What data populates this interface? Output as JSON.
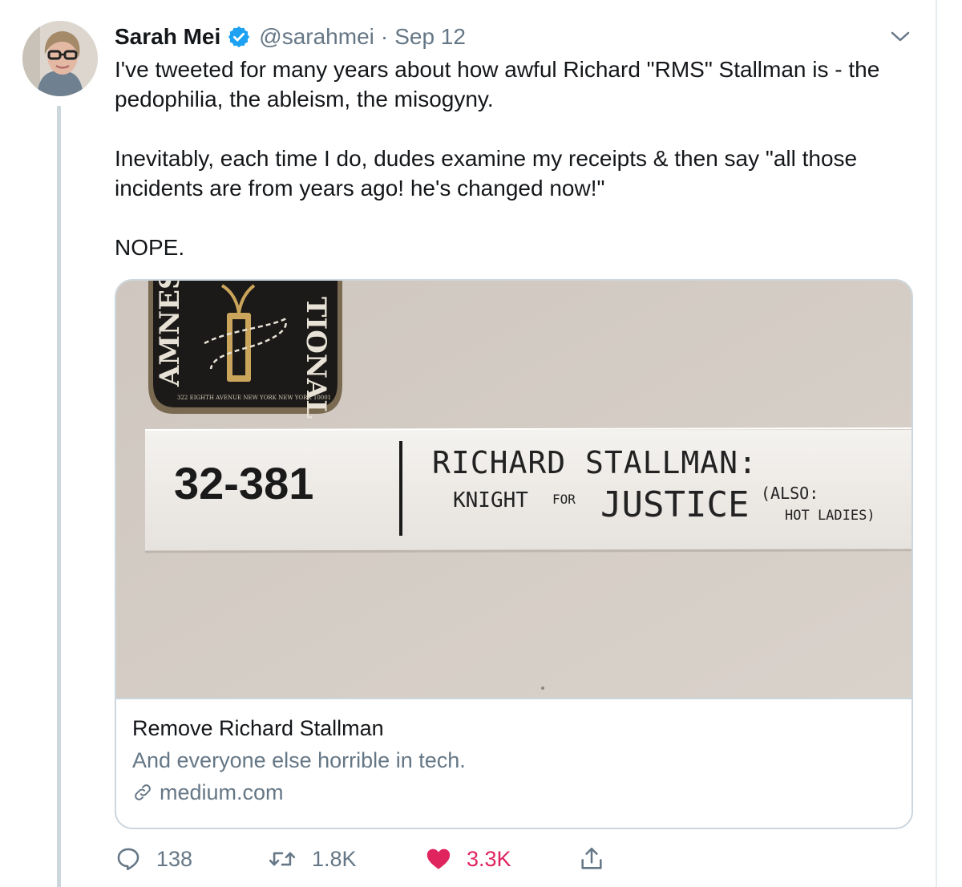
{
  "tweet": {
    "author_name": "Sarah Mei",
    "handle": "@sarahmei",
    "separator": "·",
    "date": "Sep 12",
    "paragraphs": [
      "I've tweeted for many years about how awful Richard \"RMS\" Stallman is - the pedophilia, the ableism, the misogyny.",
      "Inevitably, each time I do, dudes examine my receipts & then say \"all those incidents are from years ago! he's changed now!\"",
      "NOPE."
    ]
  },
  "card": {
    "image_text": {
      "room_number": "32-381",
      "sign_line1": "RICHARD STALLMAN:",
      "sign_line2a": "KNIGHT",
      "sign_line2b": "FOR",
      "sign_line2c": "JUSTICE",
      "sign_line3a": "(ALSO:",
      "sign_line3b": "HOT LADIES)",
      "plaque_left": "AMNES",
      "plaque_right": "TIONAL",
      "plaque_address": "322 EIGHTH AVENUE NEW YORK NEW YORK 10001"
    },
    "title": "Remove Richard Stallman",
    "description": "And everyone else horrible in tech.",
    "domain": "medium.com"
  },
  "actions": {
    "replies": "138",
    "retweets": "1.8K",
    "likes": "3.3K"
  },
  "icons": {
    "verified": "verified-badge-icon",
    "menu": "chevron-down-icon",
    "link": "link-icon",
    "reply": "reply-icon",
    "retweet": "retweet-icon",
    "like": "heart-icon",
    "share": "share-icon"
  },
  "colors": {
    "verified_blue": "#1da1f2",
    "secondary_text": "#657786",
    "like_red": "#e0245e",
    "border": "#ccd6dd"
  }
}
